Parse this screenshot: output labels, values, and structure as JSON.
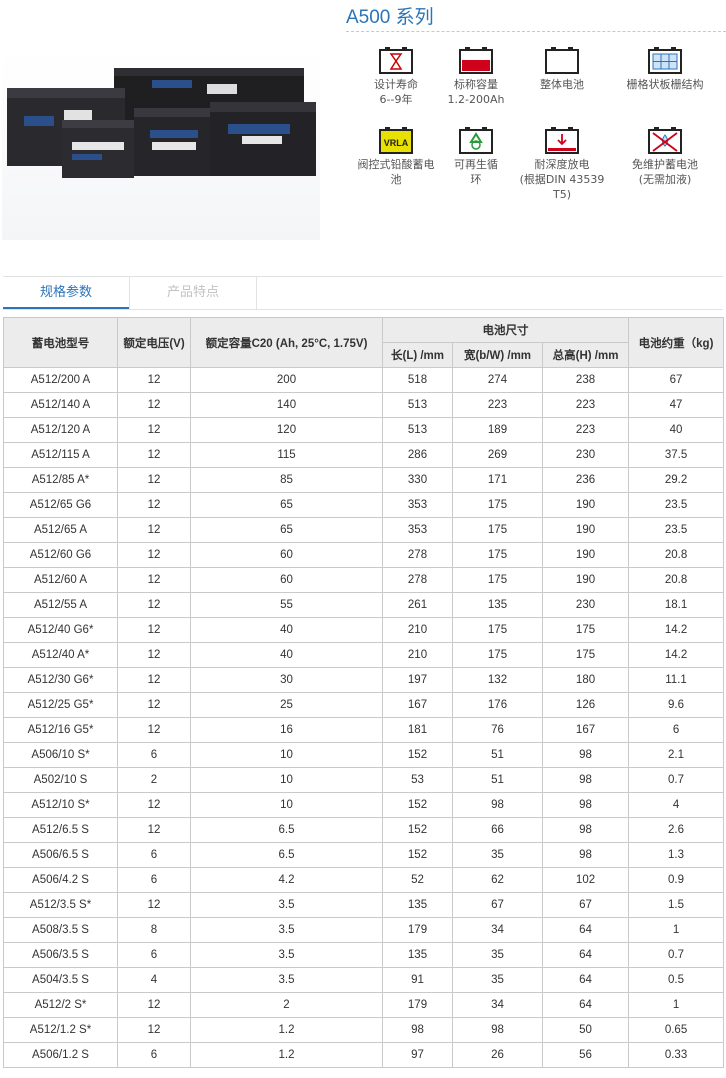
{
  "title": "A500 系列",
  "features": [
    {
      "icon": "hourglass-life-icon",
      "lines": [
        "设计寿命",
        "6--9年"
      ]
    },
    {
      "icon": "red-capacity-battery-icon",
      "lines": [
        "标称容量",
        "1.2-200Ah"
      ]
    },
    {
      "icon": "battery-outline-icon",
      "lines": [
        "整体电池"
      ]
    },
    {
      "icon": "grid-plate-icon",
      "lines": [
        "栅格状板栅结构"
      ]
    },
    {
      "icon": "vrla-icon",
      "badge": "VRLA",
      "lines": [
        "阀控式铅酸蓄电",
        "池"
      ]
    },
    {
      "icon": "recycle-icon",
      "lines": [
        "可再生循",
        "环"
      ]
    },
    {
      "icon": "deep-discharge-icon",
      "lines": [
        "耐深度放电",
        "(根据DIN 43539",
        "T5)"
      ]
    },
    {
      "icon": "no-water-icon",
      "lines": [
        "免维护蓄电池",
        "(无需加液)"
      ]
    }
  ],
  "tabs": [
    "规格参数",
    "产品特点"
  ],
  "table": {
    "headers": {
      "model": "蓄电池型号",
      "voltage": "额定电压(V)",
      "capacity": "额定容量C20 (Ah, 25°C, 1.75V)",
      "size": "电池尺寸",
      "length": "长(L) /mm",
      "width": "宽(b/W) /mm",
      "height": "总高(H) /mm",
      "weight": "电池约重（kg)"
    },
    "rows": [
      [
        "A512/200 A",
        "12",
        "200",
        "518",
        "274",
        "238",
        "67"
      ],
      [
        "A512/140 A",
        "12",
        "140",
        "513",
        "223",
        "223",
        "47"
      ],
      [
        "A512/120 A",
        "12",
        "120",
        "513",
        "189",
        "223",
        "40"
      ],
      [
        "A512/115 A",
        "12",
        "115",
        "286",
        "269",
        "230",
        "37.5"
      ],
      [
        "A512/85 A*",
        "12",
        "85",
        "330",
        "171",
        "236",
        "29.2"
      ],
      [
        "A512/65 G6",
        "12",
        "65",
        "353",
        "175",
        "190",
        "23.5"
      ],
      [
        "A512/65 A",
        "12",
        "65",
        "353",
        "175",
        "190",
        "23.5"
      ],
      [
        "A512/60 G6",
        "12",
        "60",
        "278",
        "175",
        "190",
        "20.8"
      ],
      [
        "A512/60 A",
        "12",
        "60",
        "278",
        "175",
        "190",
        "20.8"
      ],
      [
        "A512/55 A",
        "12",
        "55",
        "261",
        "135",
        "230",
        "18.1"
      ],
      [
        "A512/40 G6*",
        "12",
        "40",
        "210",
        "175",
        "175",
        "14.2"
      ],
      [
        "A512/40 A*",
        "12",
        "40",
        "210",
        "175",
        "175",
        "14.2"
      ],
      [
        "A512/30 G6*",
        "12",
        "30",
        "197",
        "132",
        "180",
        "11.1"
      ],
      [
        "A512/25 G5*",
        "12",
        "25",
        "167",
        "176",
        "126",
        "9.6"
      ],
      [
        "A512/16 G5*",
        "12",
        "16",
        "181",
        "76",
        "167",
        "6"
      ],
      [
        "A506/10 S*",
        "6",
        "10",
        "152",
        "51",
        "98",
        "2.1"
      ],
      [
        "A502/10 S",
        "2",
        "10",
        "53",
        "51",
        "98",
        "0.7"
      ],
      [
        "A512/10 S*",
        "12",
        "10",
        "152",
        "98",
        "98",
        "4"
      ],
      [
        "A512/6.5 S",
        "12",
        "6.5",
        "152",
        "66",
        "98",
        "2.6"
      ],
      [
        "A506/6.5 S",
        "6",
        "6.5",
        "152",
        "35",
        "98",
        "1.3"
      ],
      [
        "A506/4.2 S",
        "6",
        "4.2",
        "52",
        "62",
        "102",
        "0.9"
      ],
      [
        "A512/3.5 S*",
        "12",
        "3.5",
        "135",
        "67",
        "67",
        "1.5"
      ],
      [
        "A508/3.5 S",
        "8",
        "3.5",
        "179",
        "34",
        "64",
        "1"
      ],
      [
        "A506/3.5 S",
        "6",
        "3.5",
        "135",
        "35",
        "64",
        "0.7"
      ],
      [
        "A504/3.5 S",
        "4",
        "3.5",
        "91",
        "35",
        "64",
        "0.5"
      ],
      [
        "A512/2 S*",
        "12",
        "2",
        "179",
        "34",
        "64",
        "1"
      ],
      [
        "A512/1.2 S*",
        "12",
        "1.2",
        "98",
        "98",
        "50",
        "0.65"
      ],
      [
        "A506/1.2 S",
        "6",
        "1.2",
        "97",
        "26",
        "56",
        "0.33"
      ]
    ]
  }
}
